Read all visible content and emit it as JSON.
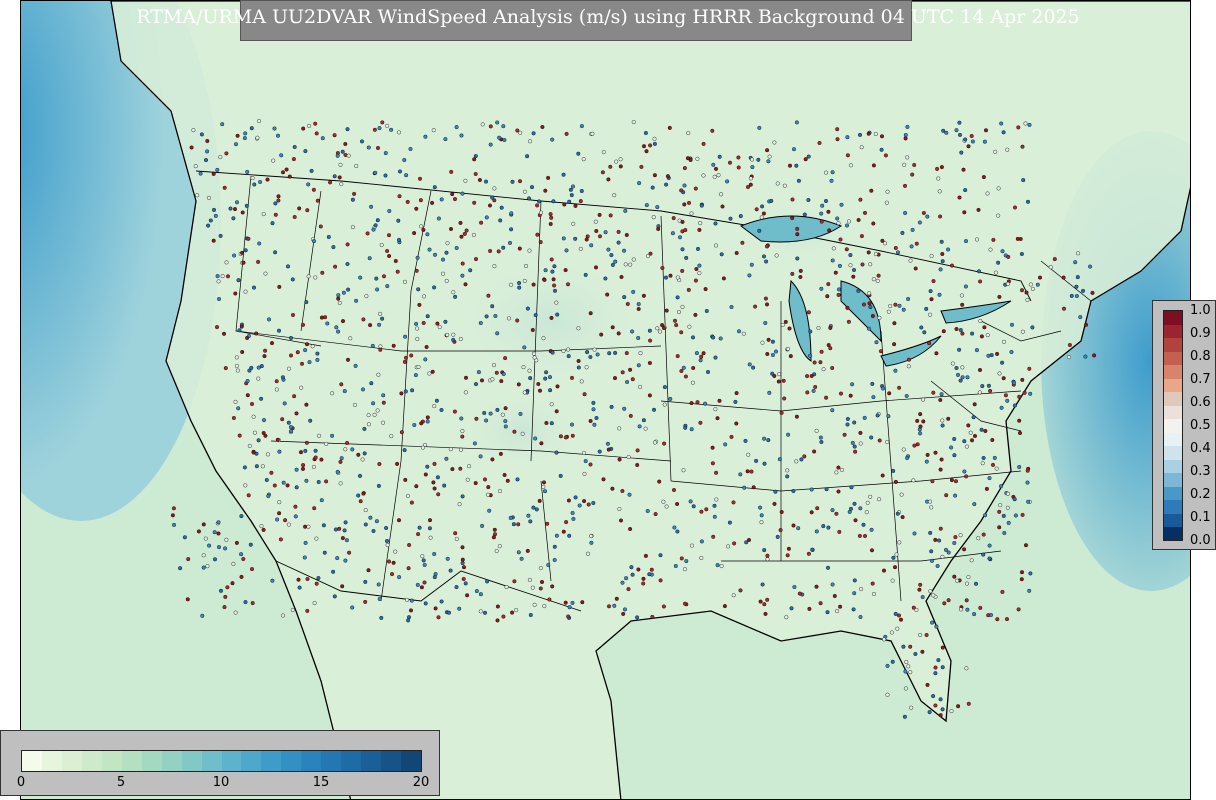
{
  "title": "RTMA/URMA UU2DVAR WindSpeed Analysis (m/s) using HRRR Background 04 UTC 14 Apr 2025",
  "right_colorbar": {
    "labels": [
      "1.0",
      "0.9",
      "0.8",
      "0.7",
      "0.6",
      "0.5",
      "0.4",
      "0.3",
      "0.2",
      "0.1",
      "0.0"
    ],
    "colors": [
      "#053061",
      "#1a5a9a",
      "#2f7ab8",
      "#4a98c8",
      "#7cb8d6",
      "#a9d0e3",
      "#cfe3ec",
      "#e8f1f3",
      "#f4f2ef",
      "#ece1da",
      "#e0c8bb",
      "#e8a789",
      "#d8846a",
      "#c4604f",
      "#b1433e",
      "#9a2530",
      "#7d0f22"
    ]
  },
  "bottom_colorbar": {
    "labels": [
      "0",
      "5",
      "10",
      "15",
      "20"
    ],
    "colors": [
      "#f5fbea",
      "#e8f5dd",
      "#dbf0d2",
      "#cfeacb",
      "#c2e5c3",
      "#b4dfc0",
      "#a4d9c1",
      "#93d1c3",
      "#82c8c6",
      "#6fbec9",
      "#5db3cc",
      "#4da8cc",
      "#3f9cc8",
      "#3390c3",
      "#2a84bc",
      "#2378b2",
      "#1e6ca6",
      "#1a5f98",
      "#165388",
      "#124676"
    ]
  },
  "map": {
    "ocean_color": "#47a5d0",
    "land_color": "#dff2dc",
    "obs_colors": [
      "#8b1a1a",
      "#a82a2a",
      "#2a6ea8",
      "#3b87c0",
      "#e6efe8"
    ]
  }
}
